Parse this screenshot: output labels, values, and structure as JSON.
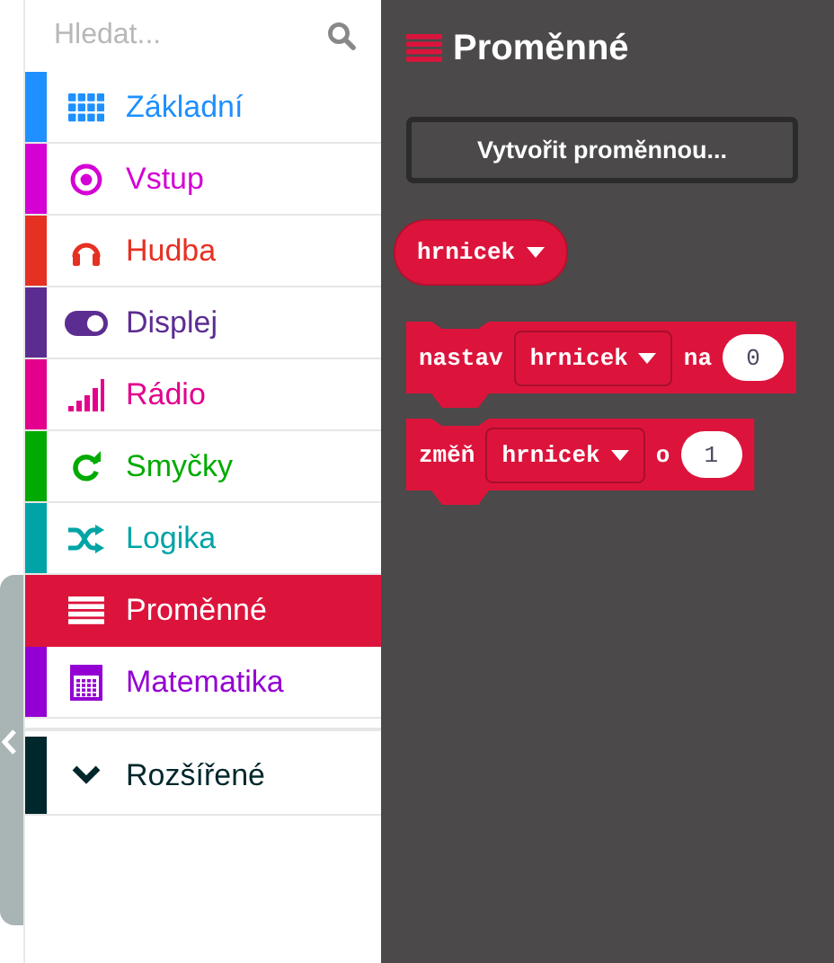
{
  "search": {
    "placeholder": "Hledat..."
  },
  "categories": [
    {
      "label": "Základní",
      "kind": "grid",
      "color": "#1e90ff",
      "selected": false
    },
    {
      "label": "Vstup",
      "kind": "target",
      "color": "#d400d4",
      "selected": false
    },
    {
      "label": "Hudba",
      "kind": "headphones",
      "color": "#e63022",
      "selected": false
    },
    {
      "label": "Displej",
      "kind": "toggle",
      "color": "#5c2d91",
      "selected": false
    },
    {
      "label": "Rádio",
      "kind": "signal",
      "color": "#e3008c",
      "selected": false
    },
    {
      "label": "Smyčky",
      "kind": "loop",
      "color": "#00aa00",
      "selected": false
    },
    {
      "label": "Logika",
      "kind": "shuffle",
      "color": "#00a4a6",
      "selected": false
    },
    {
      "label": "Proměnné",
      "kind": "lines",
      "color": "#dc143c",
      "selected": true
    },
    {
      "label": "Matematika",
      "kind": "calculator",
      "color": "#9400d3",
      "selected": false
    }
  ],
  "advanced": {
    "label": "Rozšířené",
    "color": "#00272b"
  },
  "flyout": {
    "title": "Proměnné",
    "create_button": "Vytvořit proměnnou...",
    "blocks": [
      {
        "kind": "reporter",
        "variable": "hrnicek"
      },
      {
        "kind": "statement",
        "keyword": "nastav",
        "variable": "hrnicek",
        "preposition": "na",
        "value": "0"
      },
      {
        "kind": "statement",
        "keyword": "změň",
        "variable": "hrnicek",
        "preposition": "o",
        "value": "1"
      }
    ]
  }
}
